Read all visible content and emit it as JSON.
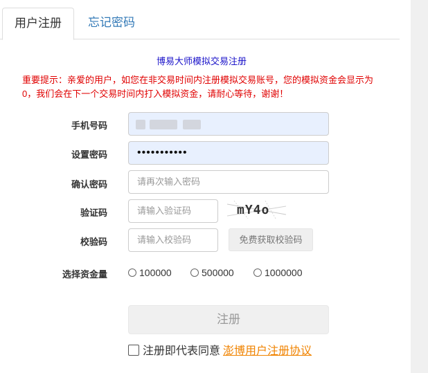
{
  "tabs": [
    {
      "label": "用户注册",
      "active": true
    },
    {
      "label": "忘记密码",
      "active": false
    }
  ],
  "subtitle": "博易大师模拟交易注册",
  "notice": "重要提示：亲爱的用户，如您在非交易时间内注册模拟交易账号，您的模拟资金会显示为0，我们会在下一个交易时间内打入模拟资金，请耐心等待，谢谢！",
  "fields": {
    "phone": {
      "label": "手机号码",
      "value": ""
    },
    "password": {
      "label": "设置密码",
      "value": "•••••••••••"
    },
    "confirm": {
      "label": "确认密码",
      "placeholder": "请再次输入密码"
    },
    "captcha": {
      "label": "验证码",
      "placeholder": "请输入验证码",
      "image_text": "mY4o"
    },
    "sms": {
      "label": "校验码",
      "placeholder": "请输入校验码",
      "button": "免费获取校验码"
    }
  },
  "funds": {
    "label": "选择资金量",
    "options": [
      "100000",
      "500000",
      "1000000"
    ]
  },
  "submit_label": "注册",
  "agreement": {
    "text": "注册即代表同意",
    "link": "澎博用户注册协议"
  },
  "colors": {
    "accent_link": "#337ab7",
    "subtitle": "#1a12c9",
    "notice": "#e00000",
    "agreement_link": "#f08300",
    "autofill_bg": "#e8f0fe"
  }
}
